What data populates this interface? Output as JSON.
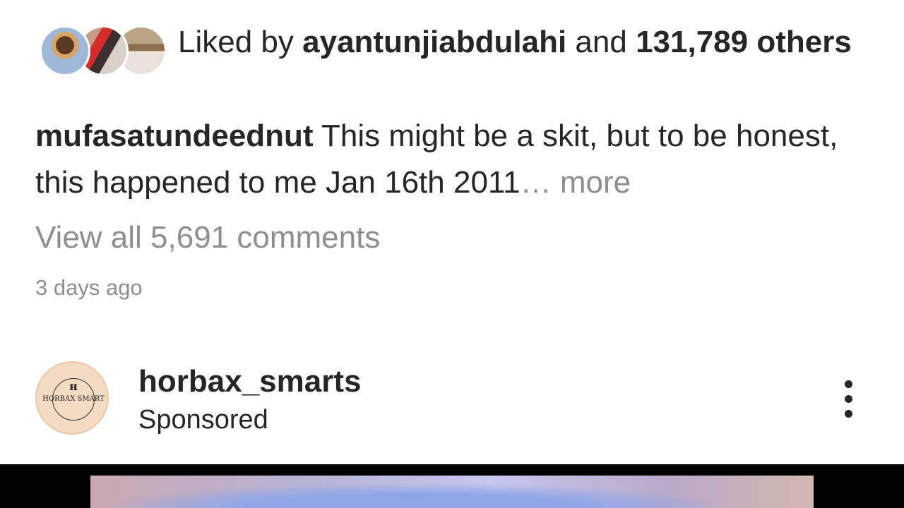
{
  "likes": {
    "prefix": "Liked by",
    "user": "ayantunjiabdulahi",
    "conjunction": "and",
    "count": "131,789",
    "suffix": "others",
    "avatars": [
      "liker-avatar",
      "liker-avatar",
      "liker-avatar"
    ]
  },
  "caption": {
    "author": "mufasatundeednut",
    "text": "This might be a skit, but to be honest, this happened to me Jan 16th 2011",
    "more": "… more"
  },
  "comments": {
    "view_all": "View all 5,691 comments"
  },
  "timestamp": "3 days ago",
  "sponsored_post": {
    "account": "horbax_smarts",
    "label": "Sponsored",
    "avatar_text": "HORBAX SMART",
    "menu_icon": "more-vertical-icon"
  },
  "colors": {
    "text_primary": "#262626",
    "text_secondary": "#8e8e8e",
    "background": "#ffffff",
    "avatar_bg": "#f4dcc4"
  }
}
